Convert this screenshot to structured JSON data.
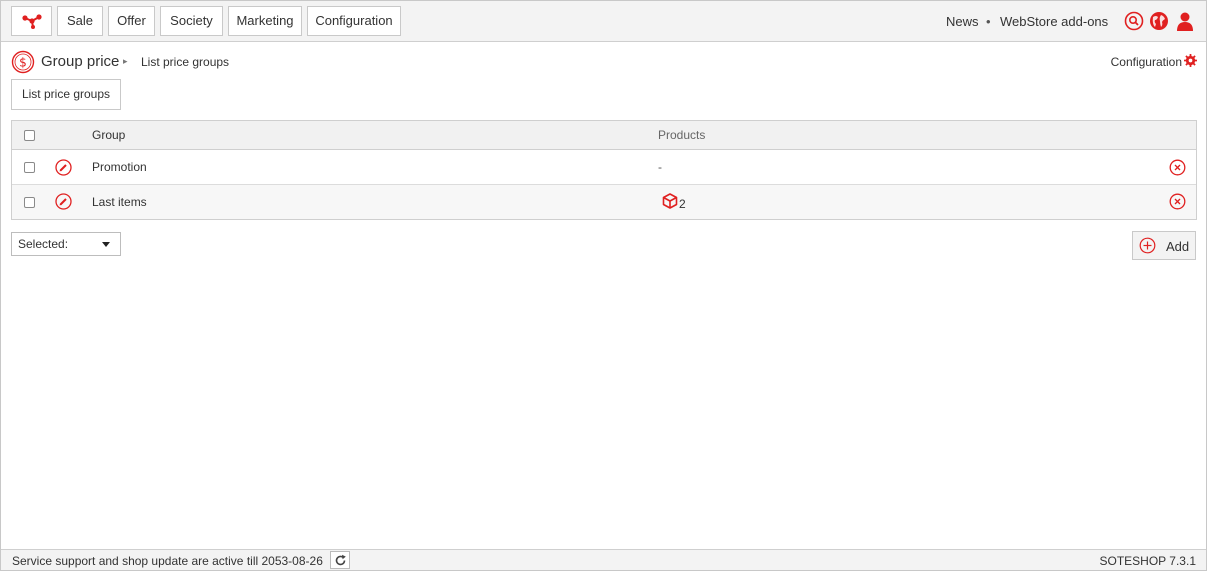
{
  "colors": {
    "accent": "#e02020",
    "toolbar_bg": "#f3f3f3",
    "border": "#c9c9c9"
  },
  "topnav": {
    "logo_icon": "network-nodes-icon",
    "items": [
      {
        "label": "Sale"
      },
      {
        "label": "Offer"
      },
      {
        "label": "Society"
      },
      {
        "label": "Marketing"
      },
      {
        "label": "Configuration"
      }
    ],
    "links": {
      "news": "News",
      "separator": "•",
      "webstore": "WebStore add-ons"
    },
    "icons": [
      "search-icon",
      "globe-icon",
      "user-icon"
    ]
  },
  "breadcrumb": {
    "icon": "dollar-circle-icon",
    "title": "Group price",
    "separator": "▸",
    "current": "List price groups",
    "config_label": "Configuration",
    "config_icon": "gear-icon"
  },
  "toolbar": {
    "list_button": "List price groups"
  },
  "table": {
    "headers": {
      "group": "Group",
      "products": "Products"
    },
    "rows": [
      {
        "group": "Promotion",
        "products": "-"
      },
      {
        "group": "Last items",
        "products": "2",
        "products_icon": "cube-icon"
      }
    ]
  },
  "actions": {
    "selected_label": "Selected:",
    "add_label": "Add",
    "add_icon": "plus-circle-icon"
  },
  "footer": {
    "status": "Service support and shop update are active till 2053-08-26",
    "refresh_icon": "refresh-icon",
    "version": "SOTESHOP 7.3.1"
  }
}
